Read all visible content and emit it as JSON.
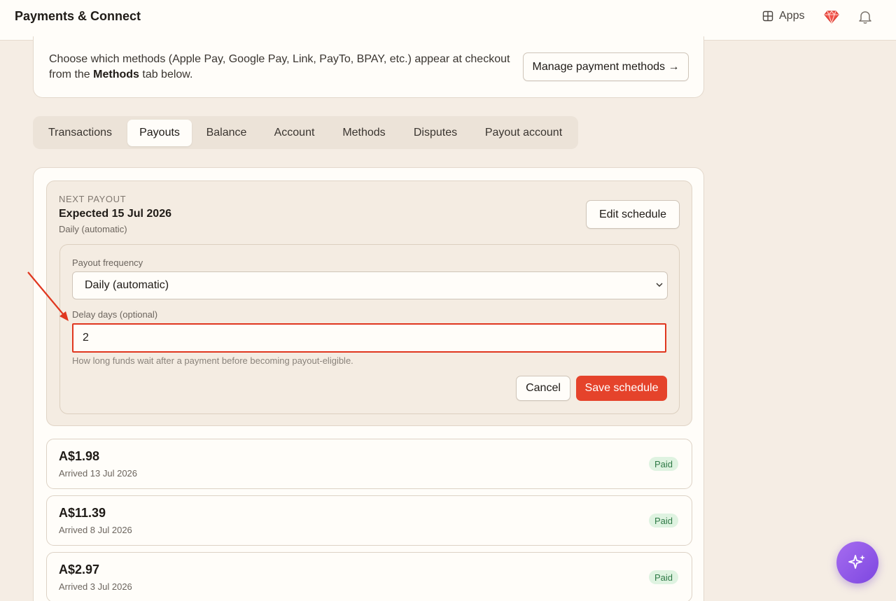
{
  "header": {
    "title": "Payments & Connect",
    "apps_label": "Apps",
    "icons": [
      "grid-icon",
      "gem-icon",
      "bell-icon"
    ]
  },
  "info": {
    "text_before": "Choose which methods (Apple Pay, Google Pay, Link, PayTo, BPAY, etc.) appear at checkout from the ",
    "text_bold": "Methods",
    "text_after": " tab below.",
    "manage_button": "Manage payment methods →"
  },
  "tabs": [
    {
      "label": "Transactions",
      "active": false
    },
    {
      "label": "Payouts",
      "active": true
    },
    {
      "label": "Balance",
      "active": false
    },
    {
      "label": "Account",
      "active": false
    },
    {
      "label": "Methods",
      "active": false
    },
    {
      "label": "Disputes",
      "active": false
    },
    {
      "label": "Payout account",
      "active": false
    }
  ],
  "next_payout": {
    "label": "NEXT PAYOUT",
    "expected": "Expected 15 Jul 2026",
    "schedule": "Daily (automatic)",
    "edit_button": "Edit schedule"
  },
  "schedule_form": {
    "frequency_label": "Payout frequency",
    "frequency_value": "Daily (automatic)",
    "delay_label": "Delay days (optional)",
    "delay_value": "2",
    "hint": "How long funds wait after a payment before becoming payout-eligible.",
    "cancel_button": "Cancel",
    "save_button": "Save schedule"
  },
  "payouts": [
    {
      "amount": "A$1.98",
      "arrived": "Arrived 13 Jul 2026",
      "status": "Paid"
    },
    {
      "amount": "A$11.39",
      "arrived": "Arrived 8 Jul 2026",
      "status": "Paid"
    },
    {
      "amount": "A$2.97",
      "arrived": "Arrived 3 Jul 2026",
      "status": "Paid"
    }
  ],
  "colors": {
    "accent": "#e5432b",
    "background": "#f5ede4",
    "paid_badge_bg": "#dff3e1",
    "paid_badge_text": "#2f7a46",
    "fab": "#8b55e8"
  },
  "fab_icon": "sparkle-icon"
}
